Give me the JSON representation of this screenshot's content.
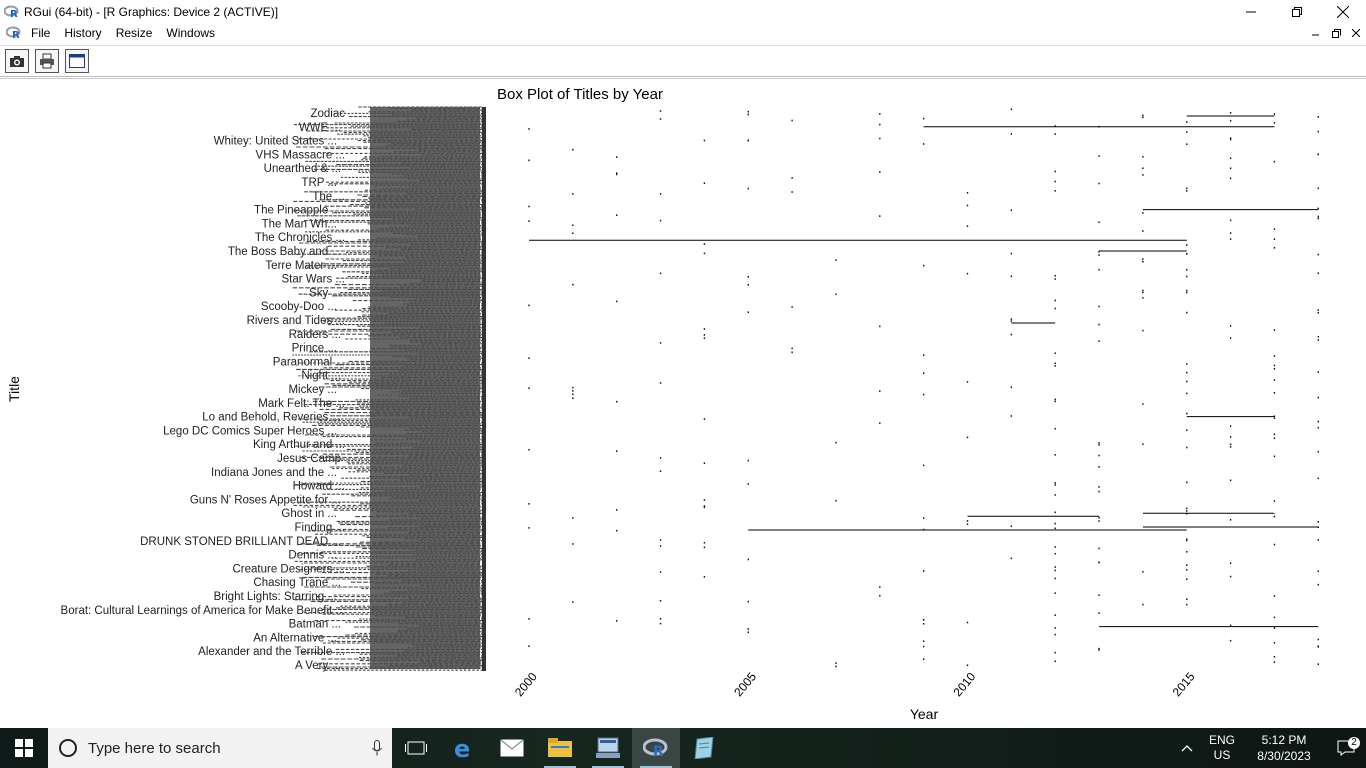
{
  "window": {
    "title": "RGui (64-bit) - [R Graphics: Device 2 (ACTIVE)]"
  },
  "menubar": {
    "items": [
      "File",
      "History",
      "Resize",
      "Windows"
    ]
  },
  "toolbar": {
    "buttons": [
      "camera-icon",
      "print-icon",
      "window-icon"
    ]
  },
  "chart_data": {
    "type": "box",
    "title": "Box Plot of Titles by Year",
    "xlabel": "Year",
    "ylabel": "Title",
    "x_ticks": [
      2000,
      2005,
      2010,
      2015
    ],
    "xlim": [
      1999,
      2020
    ],
    "y_labels_visible": [
      "Zodiac",
      "WWE ...",
      "Whitey: United States ...",
      "VHS Massacre ...",
      "Unearthed & ...",
      "TRP ...",
      "The ...",
      "The Pineapple ...",
      "The Man Wh...",
      "The Chronicles ...",
      "The Boss Baby and ...",
      "Terre Mater ...",
      "Star Wars ...",
      "Sky ...",
      "Scooby-Doo ...",
      "Rivers and Tides ...",
      "Raiders ...",
      "Prince ...",
      "Paranormal ...",
      "Night ...",
      "Mickey ...",
      "Mark Felt: The ...",
      "Lo and Behold, Reveries ...",
      "Lego DC Comics Super Heroes ...",
      "King Arthur and ...",
      "Jesus Camp",
      "Indiana Jones and the ...",
      "Howard ...",
      "Guns N' Roses Appetite for ...",
      "Ghost in ...",
      "Finding ...",
      "DRUNK STONED BRILLIANT DEAD ...",
      "Dennis ...",
      "Creature Designers ...",
      "Chasing Trane ...",
      "Bright Lights: Starring ...",
      "Borat: Cultural Learnings of America for Make Benefit ...",
      "Batman ...",
      "An Alternative ...",
      "Alexander and the Terrible ...",
      "A Very ..."
    ],
    "whisker_segments": [
      {
        "y_label": "WWE ...",
        "x": [
          2009,
          2017
        ]
      },
      {
        "y_label": "Zodiac",
        "x": [
          2015,
          2017
        ]
      },
      {
        "y_label": "The Pineapple ...",
        "x": [
          2014,
          2018
        ]
      },
      {
        "y_label": "The Chronicles ...",
        "x": [
          2000,
          2015
        ]
      },
      {
        "y_label": "The Boss Baby and ...",
        "x": [
          2013,
          2015
        ]
      },
      {
        "y_label": "Rivers and Tides ...",
        "x": [
          2011,
          2012
        ]
      },
      {
        "y_label": "Lo and Behold, Reveries ...",
        "x": [
          2015,
          2017
        ]
      },
      {
        "y_label": "Ghost in ...",
        "x": [
          2010,
          2013
        ]
      },
      {
        "y_label": "Ghost in ...",
        "x": [
          2014,
          2017
        ]
      },
      {
        "y_label": "Finding ...",
        "x": [
          2005,
          2015
        ]
      },
      {
        "y_label": "Finding ...",
        "x": [
          2014,
          2018
        ]
      },
      {
        "y_label": "Batman ...",
        "x": [
          2013,
          2018
        ]
      }
    ],
    "grid": false,
    "legend": "none"
  },
  "taskbar": {
    "search_placeholder": "Type here to search",
    "apps": [
      "edge-icon",
      "mail-icon",
      "file-explorer-icon",
      "network-app-icon",
      "r-gui-icon",
      "notepad-icon"
    ],
    "language_line1": "ENG",
    "language_line2": "US",
    "time": "5:12 PM",
    "date": "8/30/2023",
    "notification_count": "2"
  }
}
